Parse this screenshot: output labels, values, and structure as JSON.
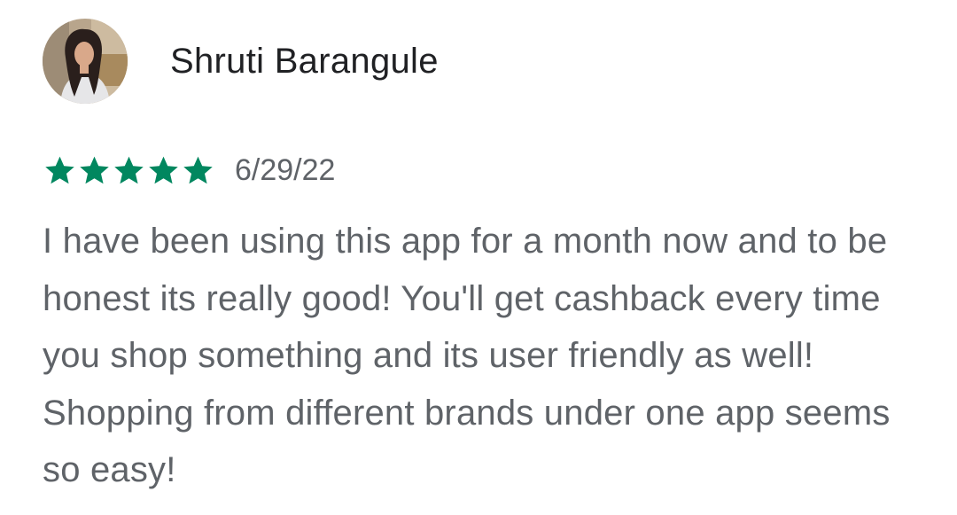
{
  "reviewer": {
    "name": "Shruti Barangule",
    "avatar_icon": "user-photo"
  },
  "rating": {
    "stars": 5,
    "max_stars": 5,
    "star_color": "#01875f",
    "date": "6/29/22"
  },
  "review": {
    "text": "I have been using this app for a month now and to be honest its really good! You'll get cashback every time you shop something and its user friendly as well! Shopping from different brands under one app seems so easy!"
  }
}
